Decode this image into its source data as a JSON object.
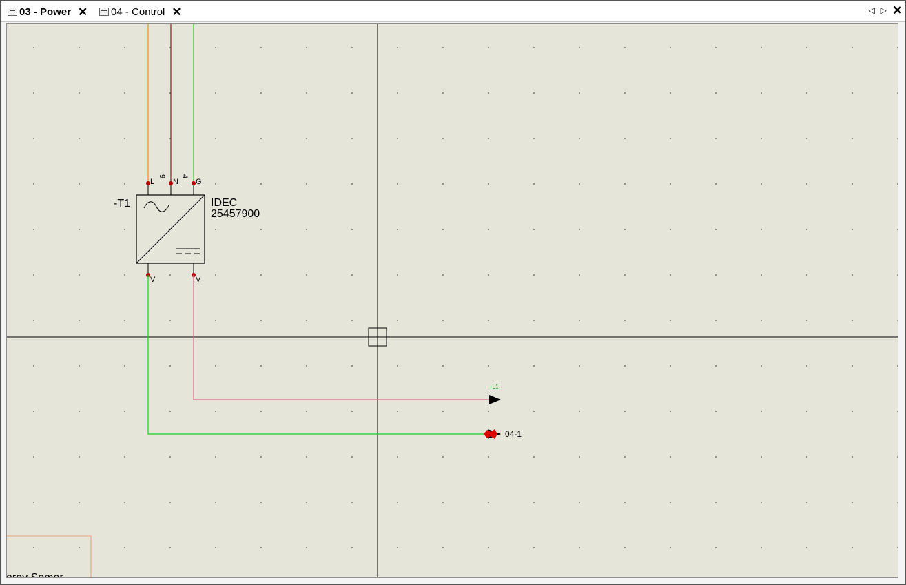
{
  "tabs": [
    {
      "label": "03 - Power",
      "active": true
    },
    {
      "label": "04 - Control",
      "active": false
    }
  ],
  "nav": {
    "prev_icon": "triangle-left-icon",
    "next_icon": "triangle-right-icon",
    "close_icon": "close-icon"
  },
  "component": {
    "tag": "-T1",
    "manufacturer": "IDEC",
    "part_number": "25457900",
    "terminals_top": [
      "L",
      "N",
      "G"
    ],
    "terminals_bottom": [
      "V",
      "V"
    ],
    "wire_numbers": [
      "9",
      "4"
    ]
  },
  "references": {
    "upper_arrow_label": "+L1-",
    "lower_arrow_label": "04-1"
  },
  "corner_text": "eroy Somer",
  "colors": {
    "canvas": "#e6e5da",
    "wire_orange": "#e8902a",
    "wire_brown": "#8b1c1c",
    "wire_green": "#22cc22",
    "wire_pink": "#e06a8a",
    "terminal_dot": "#b00000",
    "reference_red": "#e00000"
  }
}
